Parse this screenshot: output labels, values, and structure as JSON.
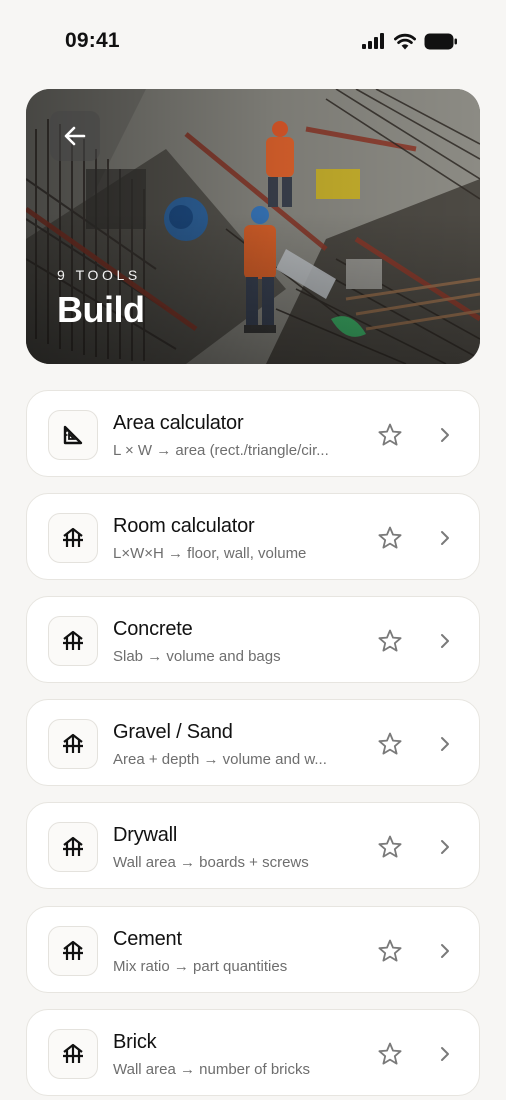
{
  "status_bar": {
    "time": "09:41",
    "icons": [
      "cellular-signal-icon",
      "wifi-icon",
      "battery-icon"
    ]
  },
  "header": {
    "back_icon": "arrow-left-icon",
    "tool_count": "9 TOOLS",
    "title": "Build"
  },
  "tools": [
    {
      "title": "Area calculator",
      "description": "L × W → area (rect./triangle/cir...",
      "icon": "set-square-icon"
    },
    {
      "title": "Room calculator",
      "description": "L×W×H → floor, wall, volume",
      "icon": "trestle-icon"
    },
    {
      "title": "Concrete",
      "description": "Slab → volume and bags",
      "icon": "trestle-icon"
    },
    {
      "title": "Gravel / Sand",
      "description": "Area + depth → volume and w...",
      "icon": "trestle-icon"
    },
    {
      "title": "Drywall",
      "description": "Wall area → boards + screws",
      "icon": "trestle-icon"
    },
    {
      "title": "Cement",
      "description": "Mix ratio → part quantities",
      "icon": "trestle-icon"
    },
    {
      "title": "Brick",
      "description": "Wall area → number of bricks",
      "icon": "trestle-icon"
    }
  ],
  "colors": {
    "background": "#f7f6f4",
    "card": "#ffffff",
    "card_border": "#e7e5e0",
    "text_primary": "#121212",
    "text_secondary": "#6e6e6e",
    "icon_muted": "#7a7a7a"
  }
}
